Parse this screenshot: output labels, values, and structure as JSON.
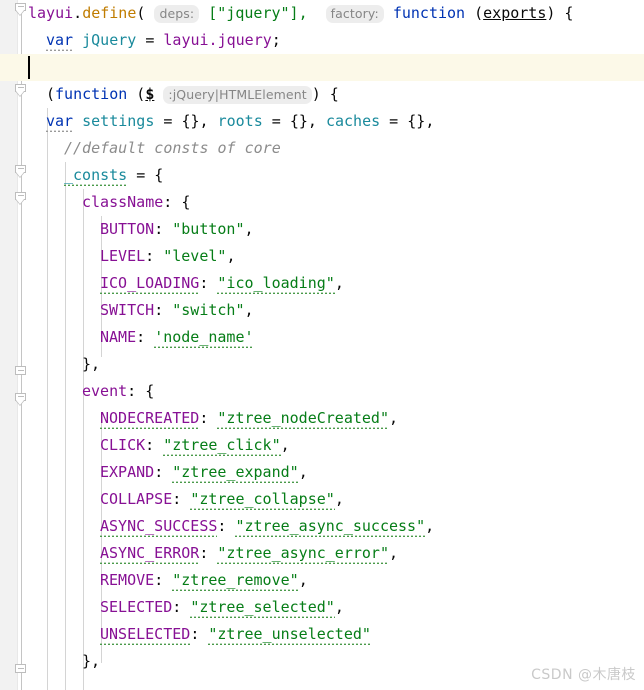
{
  "editor": {
    "language": "JavaScript",
    "theme": "light",
    "line_height_px": 27,
    "caret_line_index": 2,
    "caret_line_bg": "#fcf9e8",
    "colors": {
      "background": "#ffffff",
      "gutter_strip": "#f2f2f2",
      "keyword": "#0033b3",
      "namespace": "#871094",
      "function": "#c07c00",
      "local_variable": "#1a8a9c",
      "string": "#067d17",
      "property": "#871094",
      "comment": "#8c8c8c",
      "inlay_hint_text": "#868686",
      "inlay_hint_bg": "#ededed",
      "fold_marker": "#bdbdbd",
      "indent_guide": "#d4d4d4",
      "caret": "#000000",
      "watermark": "#c9c9c9"
    }
  },
  "code": {
    "lines": [
      {
        "indent": 0,
        "text": "layui.define( deps: [\"jquery\"],  factory: function (exports) {"
      },
      {
        "indent": 1,
        "text": "var jQuery = layui.jquery;"
      },
      {
        "indent": 1,
        "text": ""
      },
      {
        "indent": 1,
        "text": "(function ($ :jQuery|HTMLElement ) {"
      },
      {
        "indent": 1,
        "text": "var settings = {}, roots = {}, caches = {},"
      },
      {
        "indent": 2,
        "text": "//default consts of core"
      },
      {
        "indent": 2,
        "text": "_consts = {"
      },
      {
        "indent": 3,
        "text": "className: {"
      },
      {
        "indent": 4,
        "text": "BUTTON: \"button\","
      },
      {
        "indent": 4,
        "text": "LEVEL: \"level\","
      },
      {
        "indent": 4,
        "text": "ICO_LOADING: \"ico_loading\","
      },
      {
        "indent": 4,
        "text": "SWITCH: \"switch\","
      },
      {
        "indent": 4,
        "text": "NAME: 'node_name'"
      },
      {
        "indent": 3,
        "text": "},"
      },
      {
        "indent": 3,
        "text": "event: {"
      },
      {
        "indent": 4,
        "text": "NODECREATED: \"ztree_nodeCreated\","
      },
      {
        "indent": 4,
        "text": "CLICK: \"ztree_click\","
      },
      {
        "indent": 4,
        "text": "EXPAND: \"ztree_expand\","
      },
      {
        "indent": 4,
        "text": "COLLAPSE: \"ztree_collapse\","
      },
      {
        "indent": 4,
        "text": "ASYNC_SUCCESS: \"ztree_async_success\","
      },
      {
        "indent": 4,
        "text": "ASYNC_ERROR: \"ztree_async_error\","
      },
      {
        "indent": 4,
        "text": "REMOVE: \"ztree_remove\","
      },
      {
        "indent": 4,
        "text": "SELECTED: \"ztree_selected\","
      },
      {
        "indent": 4,
        "text": "UNSELECTED: \"ztree_unselected\""
      },
      {
        "indent": 3,
        "text": "},"
      }
    ],
    "tokens": {
      "l1": {
        "ns": "layui",
        "dot": ".",
        "fn": "define",
        "open": "( ",
        "hint_deps": "deps:",
        "arr": " [\"jquery\"],",
        "hint_factory": "factory:",
        "kw": "function",
        "paren_open": " (",
        "param": "exports",
        "paren_close": ") {"
      },
      "l2": {
        "kw": "var",
        "local": "jQuery",
        "eq": " = ",
        "ns": "layui.jquery",
        "semi": ";"
      },
      "l4": {
        "open": "(",
        "kw": "function",
        "sp": " (",
        "param": "$",
        "hint_type": ":jQuery|HTMLElement",
        "close": ") {"
      },
      "l5": {
        "kw": "var",
        "v1": "settings",
        "v2": "roots",
        "v3": "caches",
        "empty": "{}"
      },
      "l6": {
        "comment": "//default consts of core"
      },
      "l7": {
        "name": "_consts",
        "rest": " = {"
      },
      "l8": {
        "key": "className",
        "rest": ": {"
      },
      "l9": {
        "key": "BUTTON",
        "val": "\"button\""
      },
      "l10": {
        "key": "LEVEL",
        "val": "\"level\""
      },
      "l11": {
        "key": "ICO_LOADING",
        "val": "\"ico_loading\""
      },
      "l12": {
        "key": "SWITCH",
        "val": "\"switch\""
      },
      "l13": {
        "key": "NAME",
        "val": "'node_name'"
      },
      "l14": {
        "close": "},"
      },
      "l15": {
        "key": "event",
        "rest": ": {"
      },
      "l16": {
        "key": "NODECREATED",
        "val": "\"ztree_nodeCreated\""
      },
      "l17": {
        "key": "CLICK",
        "val": "\"ztree_click\""
      },
      "l18": {
        "key": "EXPAND",
        "val": "\"ztree_expand\""
      },
      "l19": {
        "key": "COLLAPSE",
        "val": "\"ztree_collapse\""
      },
      "l20": {
        "key": "ASYNC_SUCCESS",
        "val": "\"ztree_async_success\""
      },
      "l21": {
        "key": "ASYNC_ERROR",
        "val": "\"ztree_async_error\""
      },
      "l22": {
        "key": "REMOVE",
        "val": "\"ztree_remove\""
      },
      "l23": {
        "key": "SELECTED",
        "val": "\"ztree_selected\""
      },
      "l24": {
        "key": "UNSELECTED",
        "val": "\"ztree_unselected\""
      },
      "l25": {
        "close": "},"
      }
    }
  },
  "inlay_hints": [
    {
      "label": "deps:",
      "line": 1
    },
    {
      "label": "factory:",
      "line": 1
    },
    {
      "label": ":jQuery|HTMLElement",
      "line": 4
    }
  ],
  "watermark": {
    "text": "CSDN @木唐枝"
  }
}
